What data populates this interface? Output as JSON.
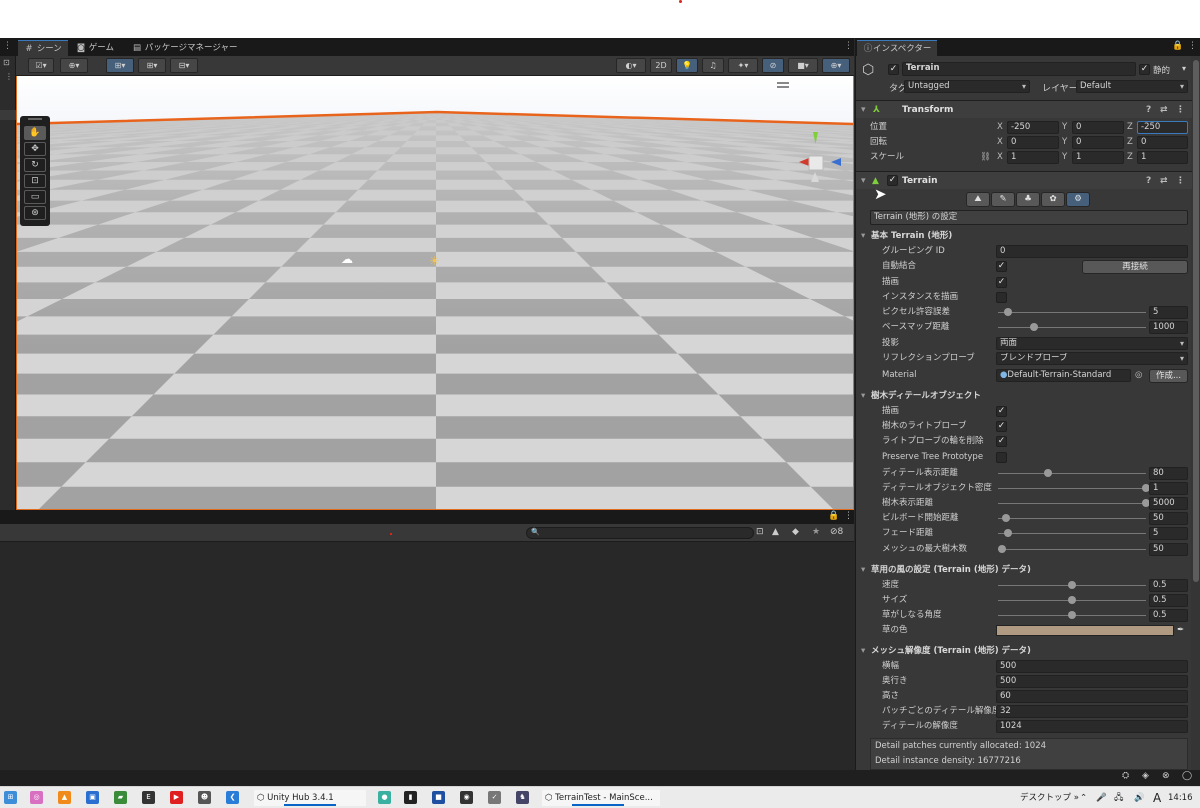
{
  "editor": {
    "tabs": [
      {
        "label": "シーン",
        "icon": "grid-icon",
        "active": true
      },
      {
        "label": "ゲーム",
        "icon": "gamepad-icon",
        "active": false
      },
      {
        "label": "パッケージマネージャー",
        "icon": "package-icon",
        "active": false
      }
    ],
    "scene_toolbar": {
      "btn_2d": "2D"
    },
    "tools": [
      "hand-tool-icon",
      "move-tool-icon",
      "rotate-tool-icon",
      "scale-tool-icon",
      "rect-tool-icon",
      "transform-tool-icon"
    ],
    "bottom_panel": {
      "counter": "8"
    }
  },
  "inspector": {
    "tab_label": "インスペクター",
    "object_name": "Terrain",
    "static_label": "静的",
    "tag_label": "タグ",
    "tag_value": "Untagged",
    "layer_label": "レイヤー",
    "layer_value": "Default",
    "transform": {
      "title": "Transform",
      "position_label": "位置",
      "rotation_label": "回転",
      "scale_label": "スケール",
      "position": {
        "x": "-250",
        "y": "0",
        "z": "-250"
      },
      "rotation": {
        "x": "0",
        "y": "0",
        "z": "0"
      },
      "scale": {
        "x": "1",
        "y": "1",
        "z": "1"
      },
      "axis_x": "X",
      "axis_y": "Y",
      "axis_z": "Z"
    },
    "terrain": {
      "title": "Terrain",
      "settings_label": "Terrain (地形) の設定",
      "basic_section": "基本 Terrain (地形)",
      "grouping_id_label": "グルーピング ID",
      "grouping_id": "0",
      "auto_connect_label": "自動結合",
      "reconnect_button": "再接続",
      "draw_label": "描画",
      "draw_instanced_label": "インスタンスを描画",
      "pixel_error_label": "ピクセル許容誤差",
      "pixel_error": "5",
      "pixel_error_fraction": 0.04,
      "basemap_dist_label": "ベースマップ距離",
      "basemap_dist": "1000",
      "basemap_fraction": 0.22,
      "shadow_label": "投影",
      "shadow_value": "両面",
      "reflection_label": "リフレクションプローブ",
      "reflection_value": "ブレンドプローブ",
      "material_label": "Material",
      "material_value": "Default-Terrain-Standard",
      "create_button": "作成...",
      "tree_section": "樹木ディテールオブジェクト",
      "tree_draw_label": "描画",
      "tree_light_probes_label": "樹木のライトプローブ",
      "light_probe_ring_label": "ライトプローブの輪を削除",
      "preserve_tree_label": "Preserve Tree Prototype",
      "detail_dist_label": "ディテール表示距離",
      "detail_dist": "80",
      "detail_dist_fraction": 0.32,
      "detail_density_label": "ディテールオブジェクト密度",
      "detail_density": "1",
      "detail_density_fraction": 1.0,
      "tree_dist_label": "樹木表示距離",
      "tree_dist": "5000",
      "tree_dist_fraction": 1.0,
      "billboard_label": "ビルボード開始距離",
      "billboard": "50",
      "billboard_fraction": 0.03,
      "fade_label": "フェード距離",
      "fade": "5",
      "fade_fraction": 0.04,
      "max_mesh_trees_label": "メッシュの最大樹木数",
      "max_mesh_trees": "50",
      "max_mesh_trees_fraction": 0.0,
      "wind_section": "草用の風の設定 (Terrain (地形) データ)",
      "speed_label": "速度",
      "speed": "0.5",
      "size_label": "サイズ",
      "size": "0.5",
      "bending_label": "草がしなる角度",
      "bending": "0.5",
      "grass_color_label": "草の色",
      "grass_color": "#b09a82",
      "mesh_section": "メッシュ解像度 (Terrain (地形) データ)",
      "width_label": "横幅",
      "width": "500",
      "length_label": "奥行き",
      "length": "500",
      "height_label": "高さ",
      "height": "60",
      "detail_per_patch_label": "パッチごとのディテール解像度",
      "detail_per_patch": "32",
      "detail_resolution_label": "ディテールの解像度",
      "detail_resolution": "1024",
      "info_line1": "Detail patches currently allocated: 1024",
      "info_line2": "Detail instance density: 16777216"
    }
  },
  "taskbar": {
    "unity_hub": "Unity Hub 3.4.1",
    "unity_project": "TerrainTest - MainSce...",
    "desktop": "デスクトップ",
    "ime": "A",
    "time": "14:16"
  },
  "colors": {
    "selection_outline": "#e06b1c",
    "accent_blue": "#3a79bb",
    "grid_dark": "#a3a3a3",
    "grid_light": "#d6d6d6"
  }
}
